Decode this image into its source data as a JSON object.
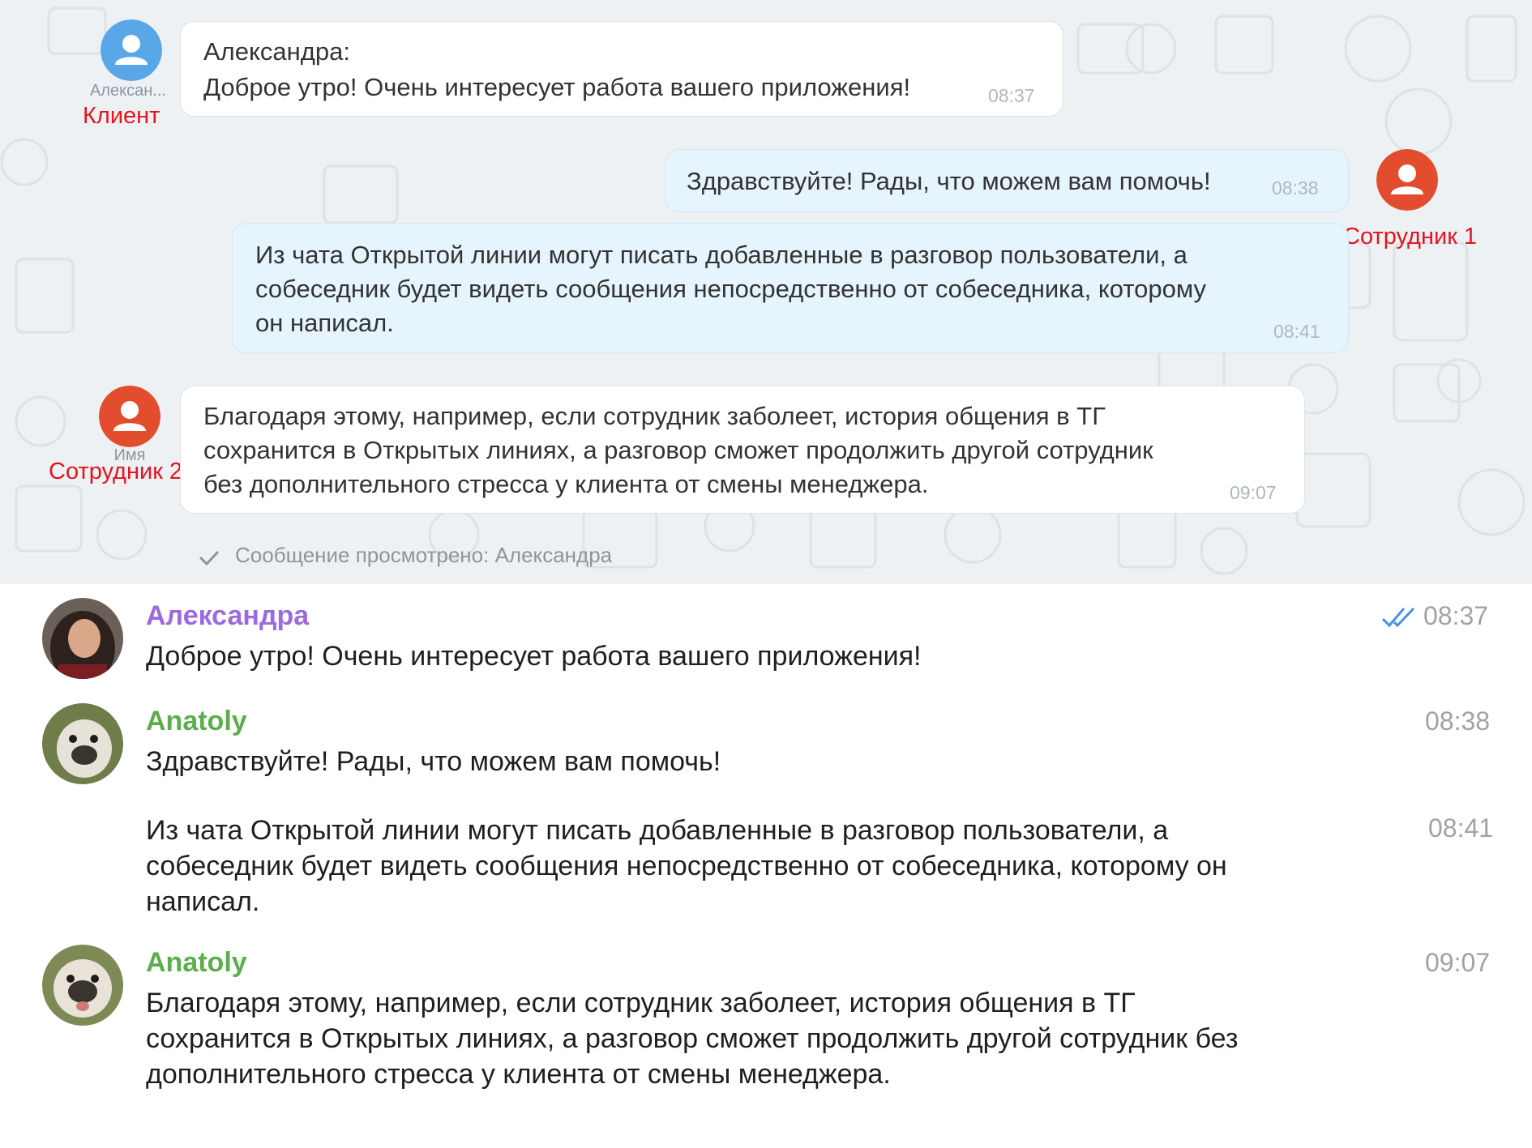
{
  "bitrix": {
    "client_avatar_name": "Алексан...",
    "client_role_label": "Клиент",
    "employee1_role_label": "Сотрудник 1",
    "employee2_avatar_name": "Имя",
    "employee2_role_label": "Сотрудник 2",
    "messages": [
      {
        "author": "Александра:",
        "text": "Доброе утро! Очень интересует работа вашего приложения!",
        "time": "08:37"
      },
      {
        "text": "Здравствуйте! Рады, что можем вам помочь!",
        "time": "08:38"
      },
      {
        "line1": "Из чата Открытой линии могут писать добавленные в разговор пользователи, а",
        "line2": "собеседник будет видеть сообщения непосредственно от собеседника, которому",
        "line3": "он написал.",
        "time": "08:41"
      },
      {
        "line1": "Благодаря этому, например, если сотрудник заболеет, история общения в ТГ",
        "line2": "сохранится в Открытых линиях, а разговор сможет продолжить другой сотрудник",
        "line3": "без дополнительного стресса у клиента от смены менеджера.",
        "time": "09:07"
      }
    ],
    "seen_status": "Сообщение просмотрено: Александра"
  },
  "telegram": {
    "colors": {
      "client_name": "#9c6ae0",
      "employee_name": "#5cae4d",
      "read_check": "#4a90e2"
    },
    "messages": [
      {
        "author": "Александра",
        "text": "Доброе утро! Очень интересует работа вашего приложения!",
        "time": "08:37",
        "read_icon": "double-check-icon"
      },
      {
        "author": "Anatoly",
        "text": "Здравствуйте! Рады, что можем вам помочь!",
        "time": "08:38"
      },
      {
        "line1": "Из чата Открытой линии могут писать добавленные в разговор пользователи, а",
        "line2": "собеседник будет видеть сообщения непосредственно от собеседника, которому он",
        "line3": "написал.",
        "time": "08:41"
      },
      {
        "author": "Anatoly",
        "line1": "Благодаря этому, например, если сотрудник заболеет, история общения в ТГ",
        "line2": "сохранится в Открытых линиях, а разговор сможет продолжить другой сотрудник без",
        "line3": "дополнительного стресса у клиента от смены менеджера.",
        "time": "09:07"
      }
    ]
  }
}
